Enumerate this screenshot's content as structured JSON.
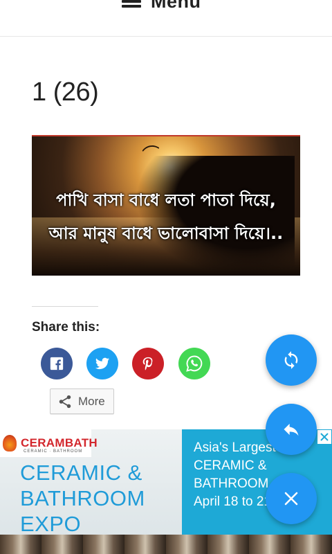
{
  "header": {
    "menu_label": "Menu"
  },
  "post": {
    "title": "1 (26)",
    "image": {
      "caption_line1": "পাখি বাসা বাধে লতা পাতা দিয়ে,",
      "caption_line2": "আর মানুষ বাধে ভালোবাসা দিয়ে।.."
    }
  },
  "share": {
    "heading": "Share this:",
    "buttons": [
      {
        "icon": "facebook-icon",
        "color": "#3b5998"
      },
      {
        "icon": "twitter-icon",
        "color": "#1da1f2"
      },
      {
        "icon": "pinterest-icon",
        "color": "#cb2027"
      },
      {
        "icon": "whatsapp-icon",
        "color": "#43d854"
      }
    ],
    "more_label": "More"
  },
  "ad": {
    "brand": "CERAMBATH",
    "brand_sub": "CERAMIC · BATHROOM",
    "headline_lines": [
      "CERAMIC &",
      "BATHROOM",
      "EXPO"
    ],
    "tagline_lines": [
      "Asia's Largest",
      "CERAMIC &",
      "BATHROOM",
      "April 18 to 21"
    ],
    "colors": {
      "brand_red": "#d3272d",
      "headline_blue": "#1f9bd8",
      "panel_blue": "#1ea9d6"
    }
  },
  "fabs": [
    {
      "icon": "refresh-icon",
      "color": "#2196f3"
    },
    {
      "icon": "reply-icon",
      "color": "#2196f3"
    },
    {
      "icon": "close-icon",
      "color": "#2196f3"
    }
  ]
}
